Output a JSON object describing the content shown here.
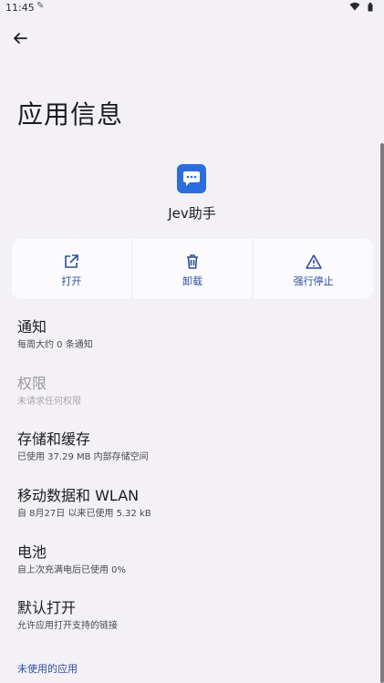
{
  "status_bar": {
    "time": "11:45",
    "icons": [
      "pencil-icon",
      "wifi-icon",
      "battery-icon"
    ]
  },
  "header": {
    "title": "应用信息"
  },
  "app": {
    "name": "Jev助手",
    "icon": "chat-bubble-icon",
    "icon_color": "#2d6cdf"
  },
  "actions": [
    {
      "label": "打开",
      "icon": "open-external-icon"
    },
    {
      "label": "卸载",
      "icon": "trash-icon"
    },
    {
      "label": "强行停止",
      "icon": "warning-icon"
    }
  ],
  "settings": [
    {
      "title": "通知",
      "subtitle": "每周大约 0 条通知",
      "enabled": true
    },
    {
      "title": "权限",
      "subtitle": "未请求任何权限",
      "enabled": false
    },
    {
      "title": "存储和缓存",
      "subtitle": "已使用 37.29 MB 内部存储空间",
      "enabled": true
    },
    {
      "title": "移动数据和 WLAN",
      "subtitle": "自 8月27日 以来已使用 5.32 kB",
      "enabled": true
    },
    {
      "title": "电池",
      "subtitle": "自上次充满电后已使用 0%",
      "enabled": true
    },
    {
      "title": "默认打开",
      "subtitle": "允许应用打开支持的链接",
      "enabled": true
    }
  ],
  "footer": {
    "unused_apps_label": "未使用的应用"
  },
  "colors": {
    "background": "#f3f1f6",
    "accent": "#2b4fa3",
    "card": "#fbfafd"
  }
}
